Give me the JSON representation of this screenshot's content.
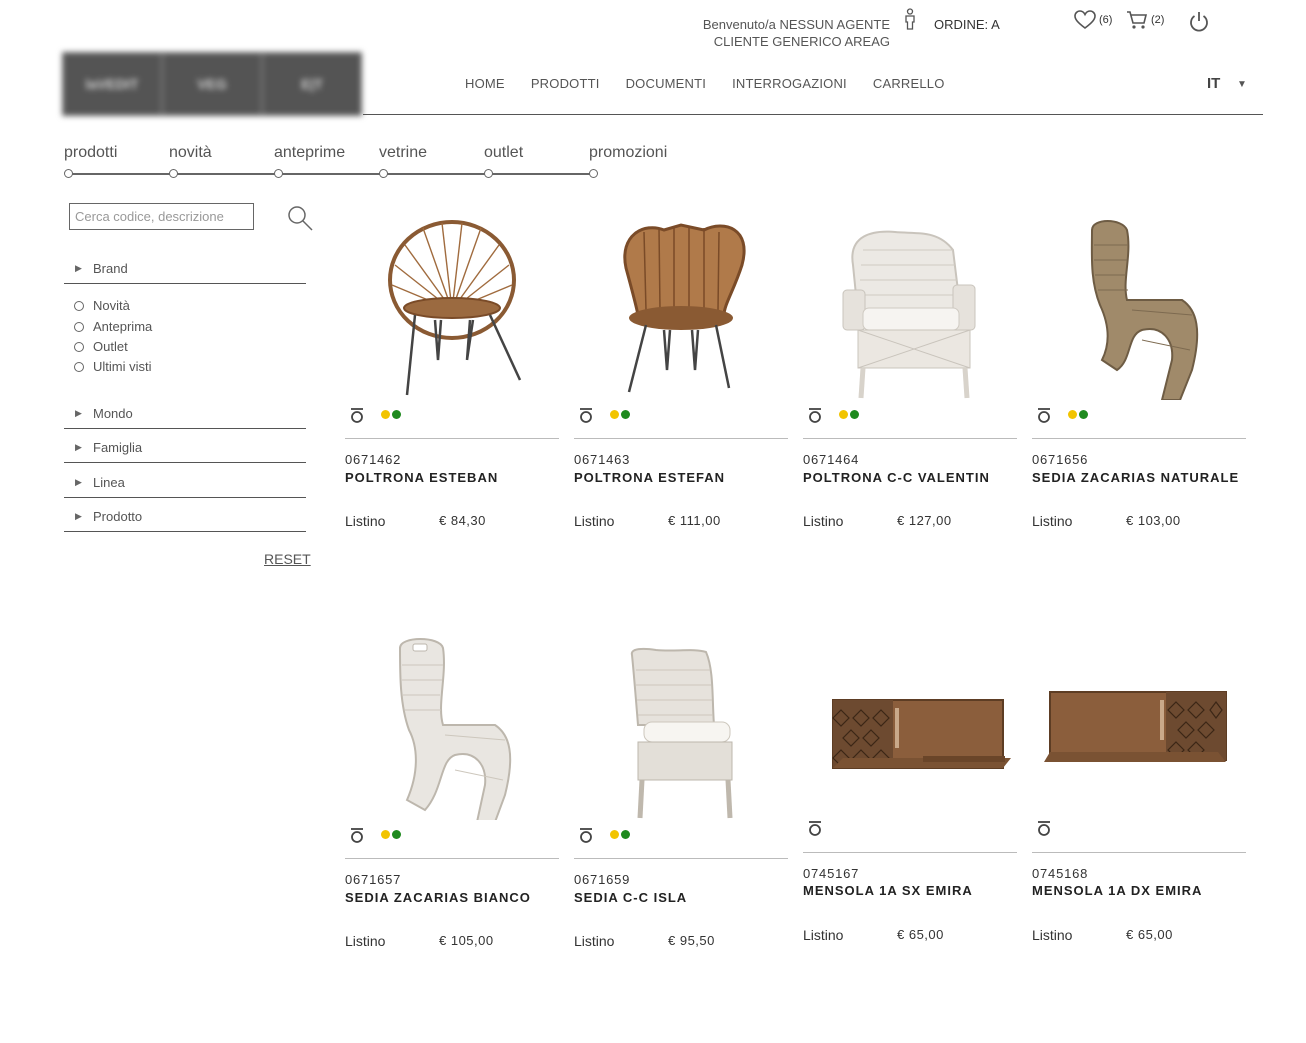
{
  "header": {
    "welcome_line1": "Benvenuto/a NESSUN AGENTE",
    "welcome_line2": "CLIENTE GENERICO AREAG",
    "order": "ORDINE: A",
    "wishlist_count": "(6)",
    "cart_count": "(2)",
    "language": "IT",
    "logo_text": [
      "laVEDIT",
      "VEG",
      "E|T"
    ]
  },
  "nav": [
    "HOME",
    "PRODOTTI",
    "DOCUMENTI",
    "INTERROGAZIONI",
    "CARRELLO"
  ],
  "tabs": [
    "prodotti",
    "novità",
    "anteprime",
    "vetrine",
    "outlet",
    "promozioni"
  ],
  "search": {
    "placeholder": "Cerca codice, descrizione"
  },
  "filters": {
    "brand": "Brand",
    "radios": [
      "Novità",
      "Anteprima",
      "Outlet",
      "Ultimi visti"
    ],
    "groups": [
      "Mondo",
      "Famiglia",
      "Linea",
      "Prodotto"
    ],
    "reset": "RESET"
  },
  "price_label": "Listino",
  "colors": {
    "yellow": "#f2c400",
    "green": "#1f8a1f"
  },
  "products": [
    {
      "code": "0671462",
      "name": "POLTRONA ESTEBAN",
      "price": "€ 84,30",
      "image": "round-rattan-chair",
      "color_dots": true
    },
    {
      "code": "0671463",
      "name": "POLTRONA ESTEFAN",
      "price": "€ 111,00",
      "image": "wingback-rattan-chair",
      "color_dots": true
    },
    {
      "code": "0671464",
      "name": "POLTRONA C-C VALENTIN",
      "price": "€ 127,00",
      "image": "white-wicker-armchair",
      "color_dots": true
    },
    {
      "code": "0671656",
      "name": "SEDIA ZACARIAS NATURALE",
      "price": "€ 103,00",
      "image": "natural-s-chair",
      "color_dots": true
    },
    {
      "code": "0671657",
      "name": "SEDIA ZACARIAS BIANCO",
      "price": "€ 105,00",
      "image": "white-s-chair",
      "color_dots": true
    },
    {
      "code": "0671659",
      "name": "SEDIA C-C ISLA",
      "price": "€ 95,50",
      "image": "white-dining-chair",
      "color_dots": true
    },
    {
      "code": "0745167",
      "name": "MENSOLA 1A SX EMIRA",
      "price": "€ 65,00",
      "image": "wall-shelf-left",
      "color_dots": false
    },
    {
      "code": "0745168",
      "name": "MENSOLA 1A DX EMIRA",
      "price": "€ 65,00",
      "image": "wall-shelf-right",
      "color_dots": false
    }
  ]
}
